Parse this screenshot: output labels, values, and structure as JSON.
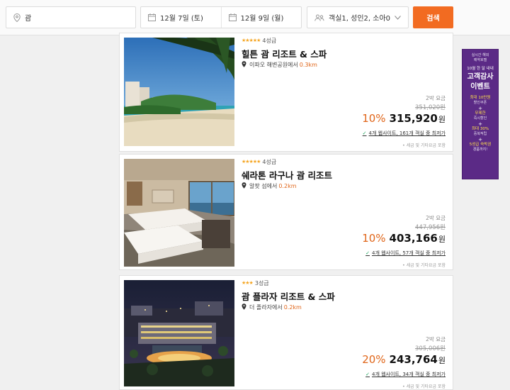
{
  "search": {
    "destination": "괌",
    "checkin": "12월 7일 (토)",
    "checkout": "12월 9일 (월)",
    "guests": "객실1, 성인2, 소아0",
    "button_label": "검색"
  },
  "hotels": [
    {
      "grade": "4성급",
      "star_count": 4,
      "name": "힐튼 괌 리조트 & 스파",
      "location": "이파오 해변공원에서",
      "distance": "0.3km",
      "per_night": "2박 요금",
      "original_price": "351,020원",
      "discount": "10%",
      "price": "315,920",
      "currency": "원",
      "sites": "4개 웹사이트, 161개 객실 중 최저가",
      "tax_note": "• 세금 및 기타요금 포함"
    },
    {
      "grade": "4성급",
      "star_count": 4,
      "name": "쉐라톤 라구나 괌 리조트",
      "location": "알팟 섬에서",
      "distance": "0.2km",
      "per_night": "2박 요금",
      "original_price": "447,956원",
      "discount": "10%",
      "price": "403,166",
      "currency": "원",
      "sites": "4개 웹사이트, 57개 객실 중 최저가",
      "tax_note": "• 세금 및 기타요금 포함"
    },
    {
      "grade": "3성급",
      "star_count": 3,
      "name": "괌 플라자 리조트 & 스파",
      "location": "더 플라자에서",
      "distance": "0.2km",
      "per_night": "2박 요금",
      "original_price": "305,006원",
      "discount": "20%",
      "price": "243,764",
      "currency": "원",
      "sites": "4개 웹사이트, 34개 객실 중 최저가",
      "tax_note": "• 세금 및 기타요금 포함"
    }
  ],
  "banner": {
    "line1": "실시간 해외",
    "line2": "예약호텔",
    "line3": "10월 한 달 내내",
    "title1": "고객감사",
    "title2": "이벤트",
    "perk1a": "최대 10만원",
    "perk1b": "할인쿠폰",
    "plus": "+",
    "perk2a": "무제한",
    "perk2b": "즉시할인",
    "perk3a": "최대 30%",
    "perk3b": "중복적립",
    "perk4a": "5성급 숙박권",
    "perk4b": "경품까지!"
  },
  "colors": {
    "accent": "#f26b21",
    "discount": "#e0661a",
    "banner_bg": "#5b2a86"
  }
}
